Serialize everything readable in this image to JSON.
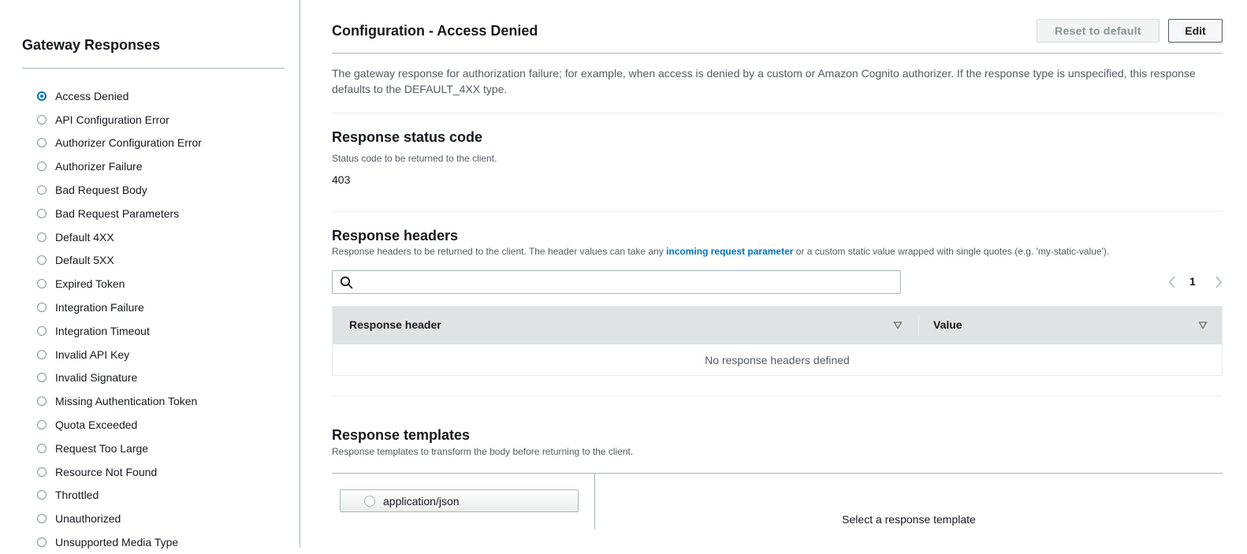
{
  "sidebar": {
    "title": "Gateway Responses",
    "items": [
      {
        "label": "Access Denied",
        "selected": true
      },
      {
        "label": "API Configuration Error",
        "selected": false
      },
      {
        "label": "Authorizer Configuration Error",
        "selected": false
      },
      {
        "label": "Authorizer Failure",
        "selected": false
      },
      {
        "label": "Bad Request Body",
        "selected": false
      },
      {
        "label": "Bad Request Parameters",
        "selected": false
      },
      {
        "label": "Default 4XX",
        "selected": false
      },
      {
        "label": "Default 5XX",
        "selected": false
      },
      {
        "label": "Expired Token",
        "selected": false
      },
      {
        "label": "Integration Failure",
        "selected": false
      },
      {
        "label": "Integration Timeout",
        "selected": false
      },
      {
        "label": "Invalid API Key",
        "selected": false
      },
      {
        "label": "Invalid Signature",
        "selected": false
      },
      {
        "label": "Missing Authentication Token",
        "selected": false
      },
      {
        "label": "Quota Exceeded",
        "selected": false
      },
      {
        "label": "Request Too Large",
        "selected": false
      },
      {
        "label": "Resource Not Found",
        "selected": false
      },
      {
        "label": "Throttled",
        "selected": false
      },
      {
        "label": "Unauthorized",
        "selected": false
      },
      {
        "label": "Unsupported Media Type",
        "selected": false
      }
    ]
  },
  "main": {
    "title": "Configuration - Access Denied",
    "reset_label": "Reset to default",
    "edit_label": "Edit",
    "description": "The gateway response for authorization failure; for example, when access is denied by a custom or Amazon Cognito authorizer. If the response type is unspecified, this response defaults to the DEFAULT_4XX type.",
    "status": {
      "title": "Response status code",
      "help": "Status code to be returned to the client.",
      "value": "403"
    },
    "headers": {
      "title": "Response headers",
      "help_before": "Response headers to be returned to the client. The header values can take any ",
      "help_link": "incoming request parameter",
      "help_after": " or a custom static value wrapped with single quotes (e.g. 'my-static-value').",
      "search_placeholder": "",
      "search_value": "",
      "page": "1",
      "col_header": "Response header",
      "col_value": "Value",
      "empty": "No response headers defined"
    },
    "templates": {
      "title": "Response templates",
      "help": "Response templates to transform the body before returning to the client.",
      "items": [
        {
          "label": "application/json",
          "selected": false
        }
      ],
      "empty": "Select a response template"
    }
  },
  "colors": {
    "accent": "#0073bb",
    "border": "#aab7b8",
    "table_header": "#dfe3e3",
    "muted_text": "#545b64"
  },
  "icons": {
    "search": "search-icon",
    "prev": "chevron-left-icon",
    "next": "chevron-right-icon",
    "sort": "sort-triangle-icon"
  }
}
